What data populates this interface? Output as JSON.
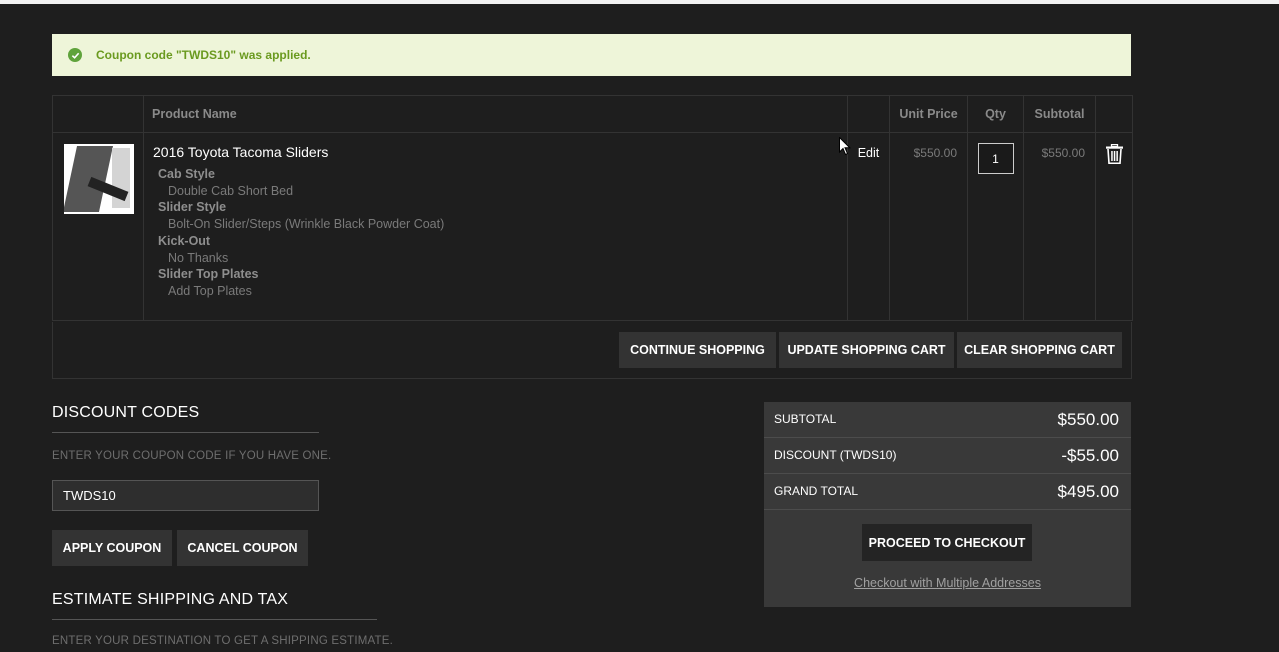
{
  "message": {
    "text": "Coupon code \"TWDS10\" was applied."
  },
  "cart": {
    "headers": {
      "product": "Product Name",
      "unit_price": "Unit Price",
      "qty": "Qty",
      "subtotal": "Subtotal"
    },
    "item": {
      "name": "2016 Toyota Tacoma Sliders",
      "options": [
        {
          "label": "Cab Style",
          "value": "Double Cab Short Bed"
        },
        {
          "label": "Slider Style",
          "value": "Bolt-On Slider/Steps (Wrinkle Black Powder Coat)"
        },
        {
          "label": "Kick-Out",
          "value": "No Thanks"
        },
        {
          "label": "Slider Top Plates",
          "value": "Add Top Plates"
        }
      ],
      "edit_label": "Edit",
      "unit_price": "$550.00",
      "qty": "1",
      "subtotal": "$550.00"
    },
    "buttons": {
      "continue": "CONTINUE SHOPPING",
      "update": "UPDATE SHOPPING CART",
      "clear": "CLEAR SHOPPING CART"
    }
  },
  "discount": {
    "title": "DISCOUNT CODES",
    "hint": "ENTER YOUR COUPON CODE IF YOU HAVE ONE.",
    "code": "TWDS10",
    "apply": "APPLY COUPON",
    "cancel": "CANCEL COUPON"
  },
  "shipping": {
    "title": "ESTIMATE SHIPPING AND TAX",
    "hint": "ENTER YOUR DESTINATION TO GET A SHIPPING ESTIMATE."
  },
  "totals": {
    "subtotal_label": "SUBTOTAL",
    "subtotal": "$550.00",
    "discount_label": "DISCOUNT (TWDS10)",
    "discount": "-$55.00",
    "grand_label": "GRAND TOTAL",
    "grand": "$495.00",
    "checkout": "PROCEED TO CHECKOUT",
    "multi": "Checkout with Multiple Addresses"
  },
  "colors": {
    "background": "#1e1e1e",
    "success_bg": "#eef5d9",
    "success_text": "#6a9a1f",
    "button": "#333333"
  }
}
